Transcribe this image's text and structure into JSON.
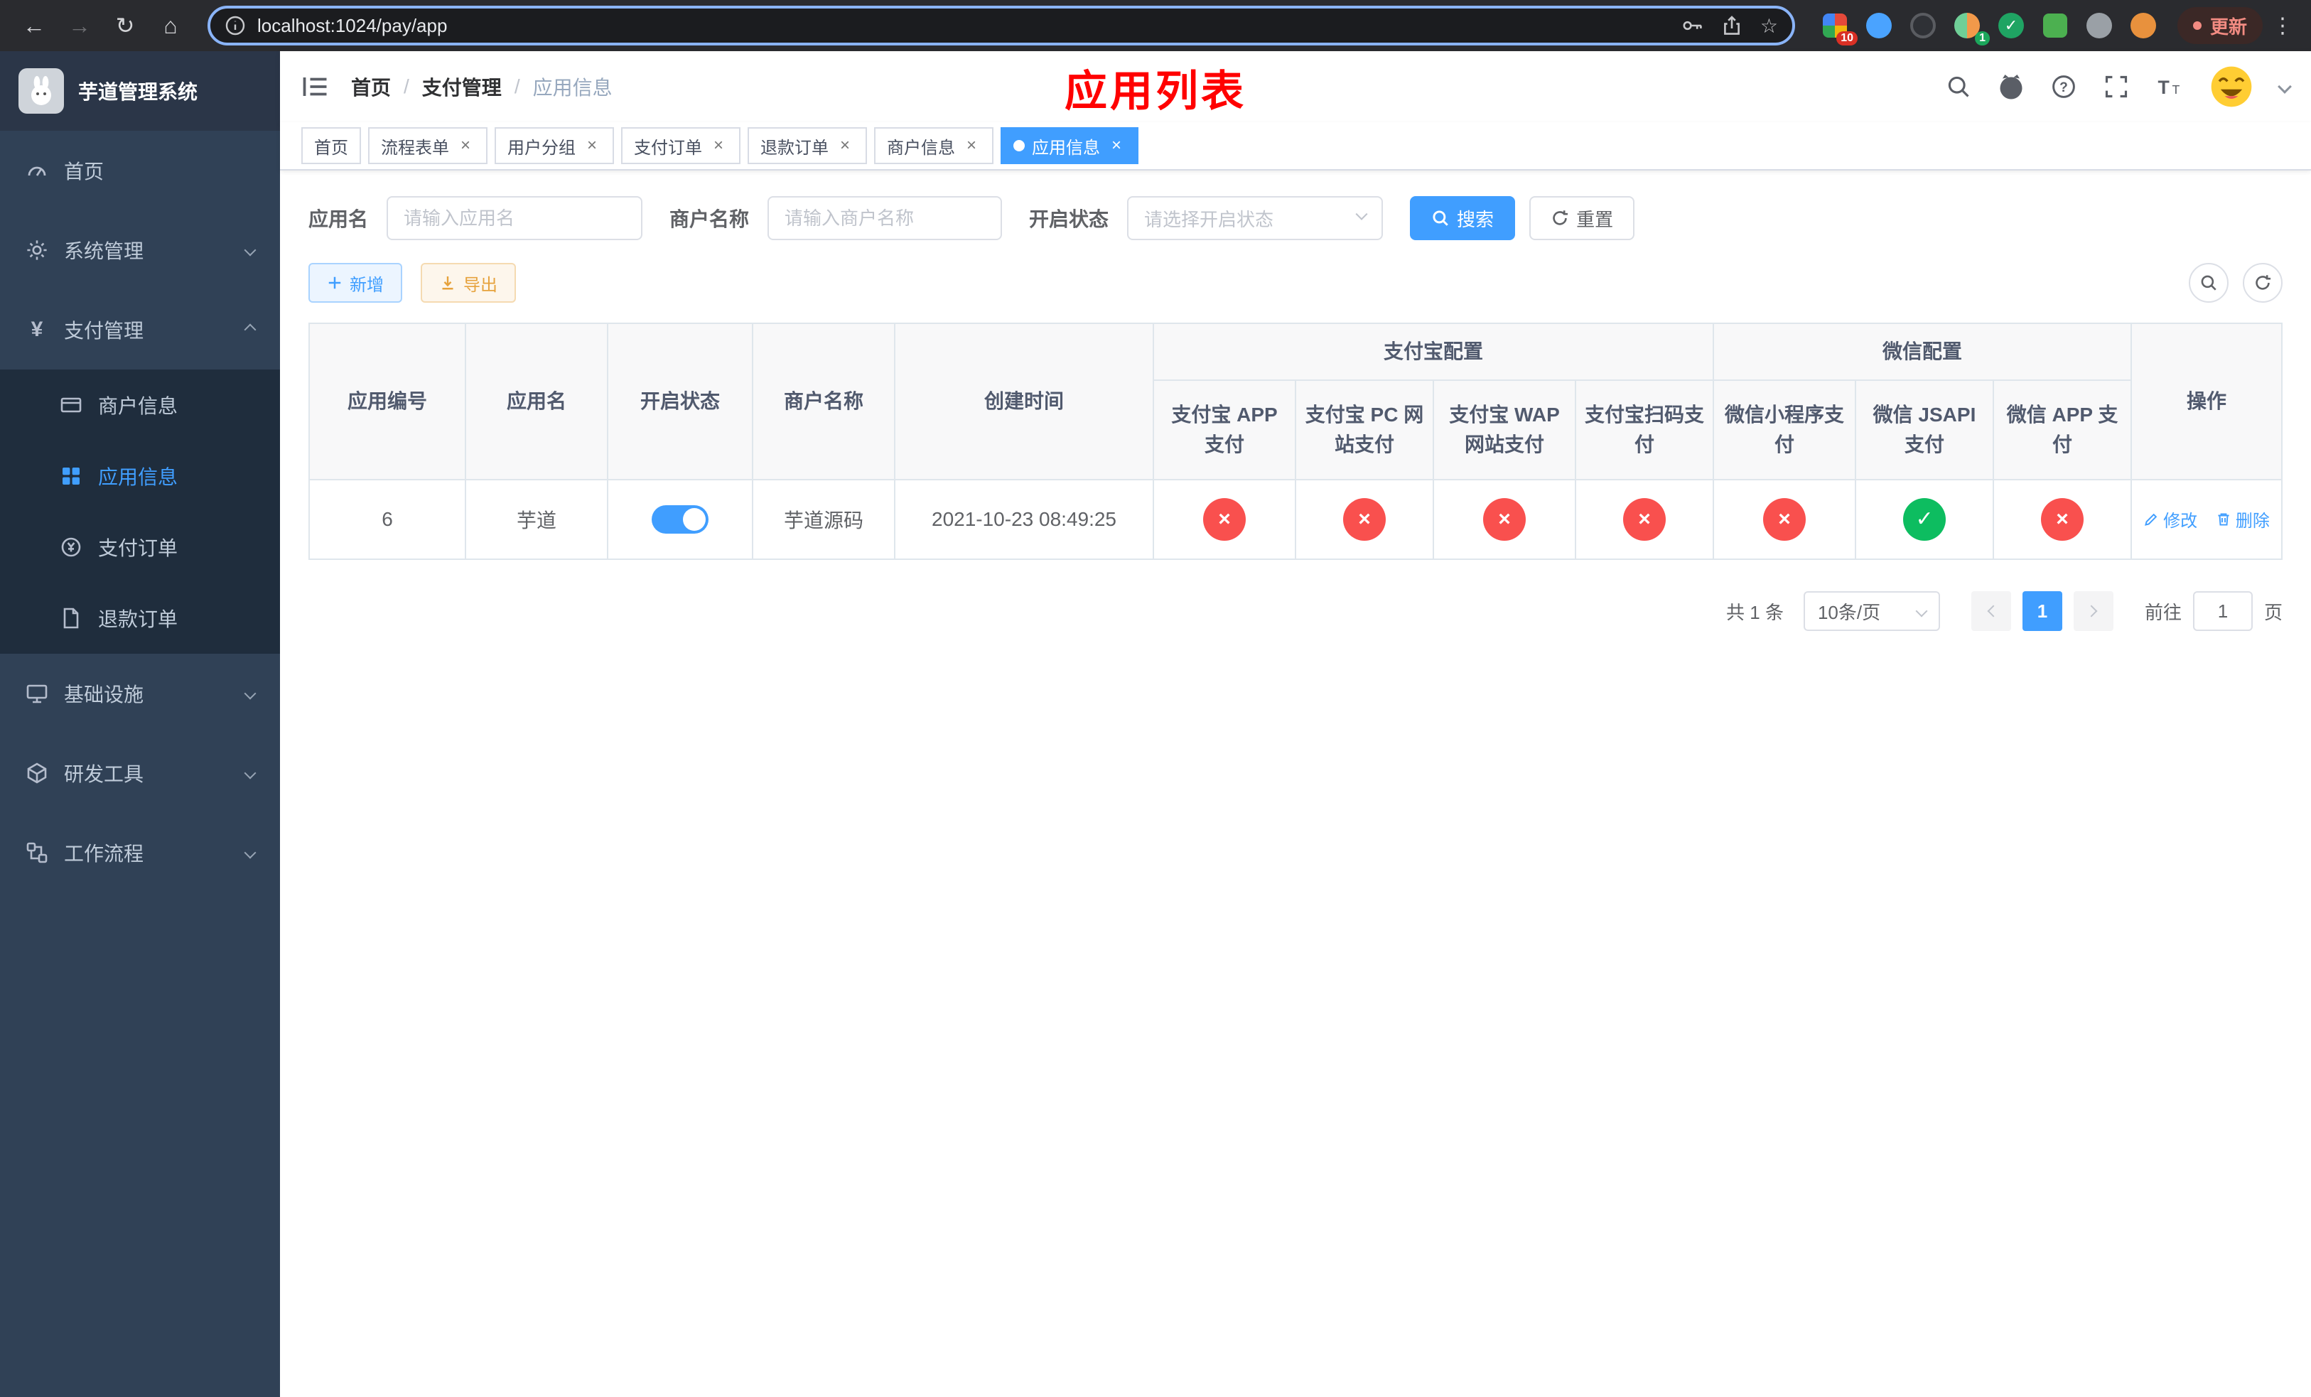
{
  "colors": {
    "accent": "#409eff",
    "danger": "#f9504e",
    "success": "#0dbd60",
    "warning": "#e6a23c",
    "title-red": "#ff0000",
    "sidebar-bg": "#304156",
    "submenu-bg": "#1f2d3d"
  },
  "icons": {
    "back": "←",
    "forward": "→",
    "reload": "↻",
    "home": "⌂",
    "star": "☆",
    "menu_dots": "⋮",
    "close": "×",
    "check": "✓",
    "cross": "×"
  },
  "browser": {
    "url": "localhost:1024/pay/app",
    "update_label": "更新",
    "extension_badges": {
      "puzzle": "10",
      "profile": "1"
    }
  },
  "sidebar": {
    "logo_title": "芋道管理系统",
    "menu": [
      {
        "label": "首页"
      },
      {
        "label": "系统管理"
      },
      {
        "label": "支付管理"
      },
      {
        "label": "基础设施"
      },
      {
        "label": "研发工具"
      },
      {
        "label": "工作流程"
      }
    ],
    "submenu": [
      {
        "label": "商户信息"
      },
      {
        "label": "应用信息"
      },
      {
        "label": "支付订单"
      },
      {
        "label": "退款订单"
      }
    ]
  },
  "header": {
    "breadcrumb": [
      "首页",
      "支付管理",
      "应用信息"
    ],
    "page_title": "应用列表"
  },
  "tabs": [
    {
      "label": "首页"
    },
    {
      "label": "流程表单"
    },
    {
      "label": "用户分组"
    },
    {
      "label": "支付订单"
    },
    {
      "label": "退款订单"
    },
    {
      "label": "商户信息"
    },
    {
      "label": "应用信息"
    }
  ],
  "filters": {
    "app_name_label": "应用名",
    "app_name_placeholder": "请输入应用名",
    "merchant_label": "商户名称",
    "merchant_placeholder": "请输入商户名称",
    "status_label": "开启状态",
    "status_placeholder": "请选择开启状态",
    "search_label": "搜索",
    "reset_label": "重置"
  },
  "actions": {
    "add": "新增",
    "export": "导出"
  },
  "table": {
    "group_headers": {
      "alipay": "支付宝配置",
      "wechat": "微信配置"
    },
    "columns": [
      "应用编号",
      "应用名",
      "开启状态",
      "商户名称",
      "创建时间",
      "支付宝 APP 支付",
      "支付宝 PC 网站支付",
      "支付宝 WAP 网站支付",
      "支付宝扫码支付",
      "微信小程序支付",
      "微信 JSAPI 支付",
      "微信 APP 支付",
      "操作"
    ],
    "row": {
      "id": "6",
      "name": "芋道",
      "status_on": true,
      "merchant": "芋道源码",
      "created": "2021-10-23 08:49:25",
      "configs": [
        "disabled",
        "disabled",
        "disabled",
        "disabled",
        "disabled",
        "enabled",
        "disabled"
      ],
      "actions": [
        "修改",
        "删除"
      ]
    }
  },
  "pagination": {
    "total": "共 1 条",
    "page_size": "10条/页",
    "page": "1",
    "goto_label": "前往",
    "goto_value": "1",
    "unit_label": "页"
  }
}
